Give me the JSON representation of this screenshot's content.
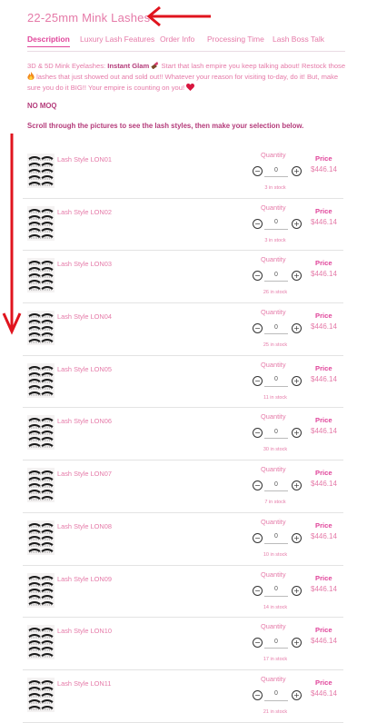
{
  "product_title": "22-25mm Mink Lashes",
  "tabs": [
    {
      "label": "Description",
      "active": true
    },
    {
      "label": "Luxury Lash Features",
      "active": false
    },
    {
      "label": "Order Info",
      "active": false
    },
    {
      "label": "Processing Time",
      "active": false
    },
    {
      "label": "Lash Boss Talk",
      "active": false
    }
  ],
  "description": {
    "p1": "3D & 5D Mink Eyelashes: ",
    "bold": "Instant Glam",
    "p2": " Start that lash empire you keep talking about! Restock those ",
    "p3": " lashes that just showed out and sold out!! Whatever your reason for visiting to-day, do it! But, make sure you do it BIG!! Your empire is counting on you! "
  },
  "moq": "NO MOQ",
  "scroll_note": "Scroll through the pictures to see the lash styles, then make your selection below.",
  "labels": {
    "quantity": "Quantity",
    "price": "Price"
  },
  "products": [
    {
      "style": "Lash Style  LON01",
      "qty": "0",
      "stock": "3 in stock",
      "price": "$446.14"
    },
    {
      "style": "Lash Style  LON02",
      "qty": "0",
      "stock": "3 in stock",
      "price": "$446.14"
    },
    {
      "style": "Lash Style  LON03",
      "qty": "0",
      "stock": "26 in stock",
      "price": "$446.14"
    },
    {
      "style": "Lash Style  LON04",
      "qty": "0",
      "stock": "25 in stock",
      "price": "$446.14"
    },
    {
      "style": "Lash Style  LON05",
      "qty": "0",
      "stock": "11 in stock",
      "price": "$446.14"
    },
    {
      "style": "Lash Style  LON06",
      "qty": "0",
      "stock": "30 in stock",
      "price": "$446.14"
    },
    {
      "style": "Lash Style  LON07",
      "qty": "0",
      "stock": "7 in stock",
      "price": "$446.14"
    },
    {
      "style": "Lash Style  LON08",
      "qty": "0",
      "stock": "10 in stock",
      "price": "$446.14"
    },
    {
      "style": "Lash Style  LON09",
      "qty": "0",
      "stock": "14 in stock",
      "price": "$446.14"
    },
    {
      "style": "Lash Style  LON10",
      "qty": "0",
      "stock": "17 in stock",
      "price": "$446.14"
    },
    {
      "style": "Lash Style  LON11",
      "qty": "0",
      "stock": "21 in stock",
      "price": "$446.14"
    }
  ],
  "colors": {
    "accent": "#e0449a",
    "text": "#e57aa8",
    "dark_accent": "#b43b7a",
    "annotation_arrow": "#e0141e"
  }
}
